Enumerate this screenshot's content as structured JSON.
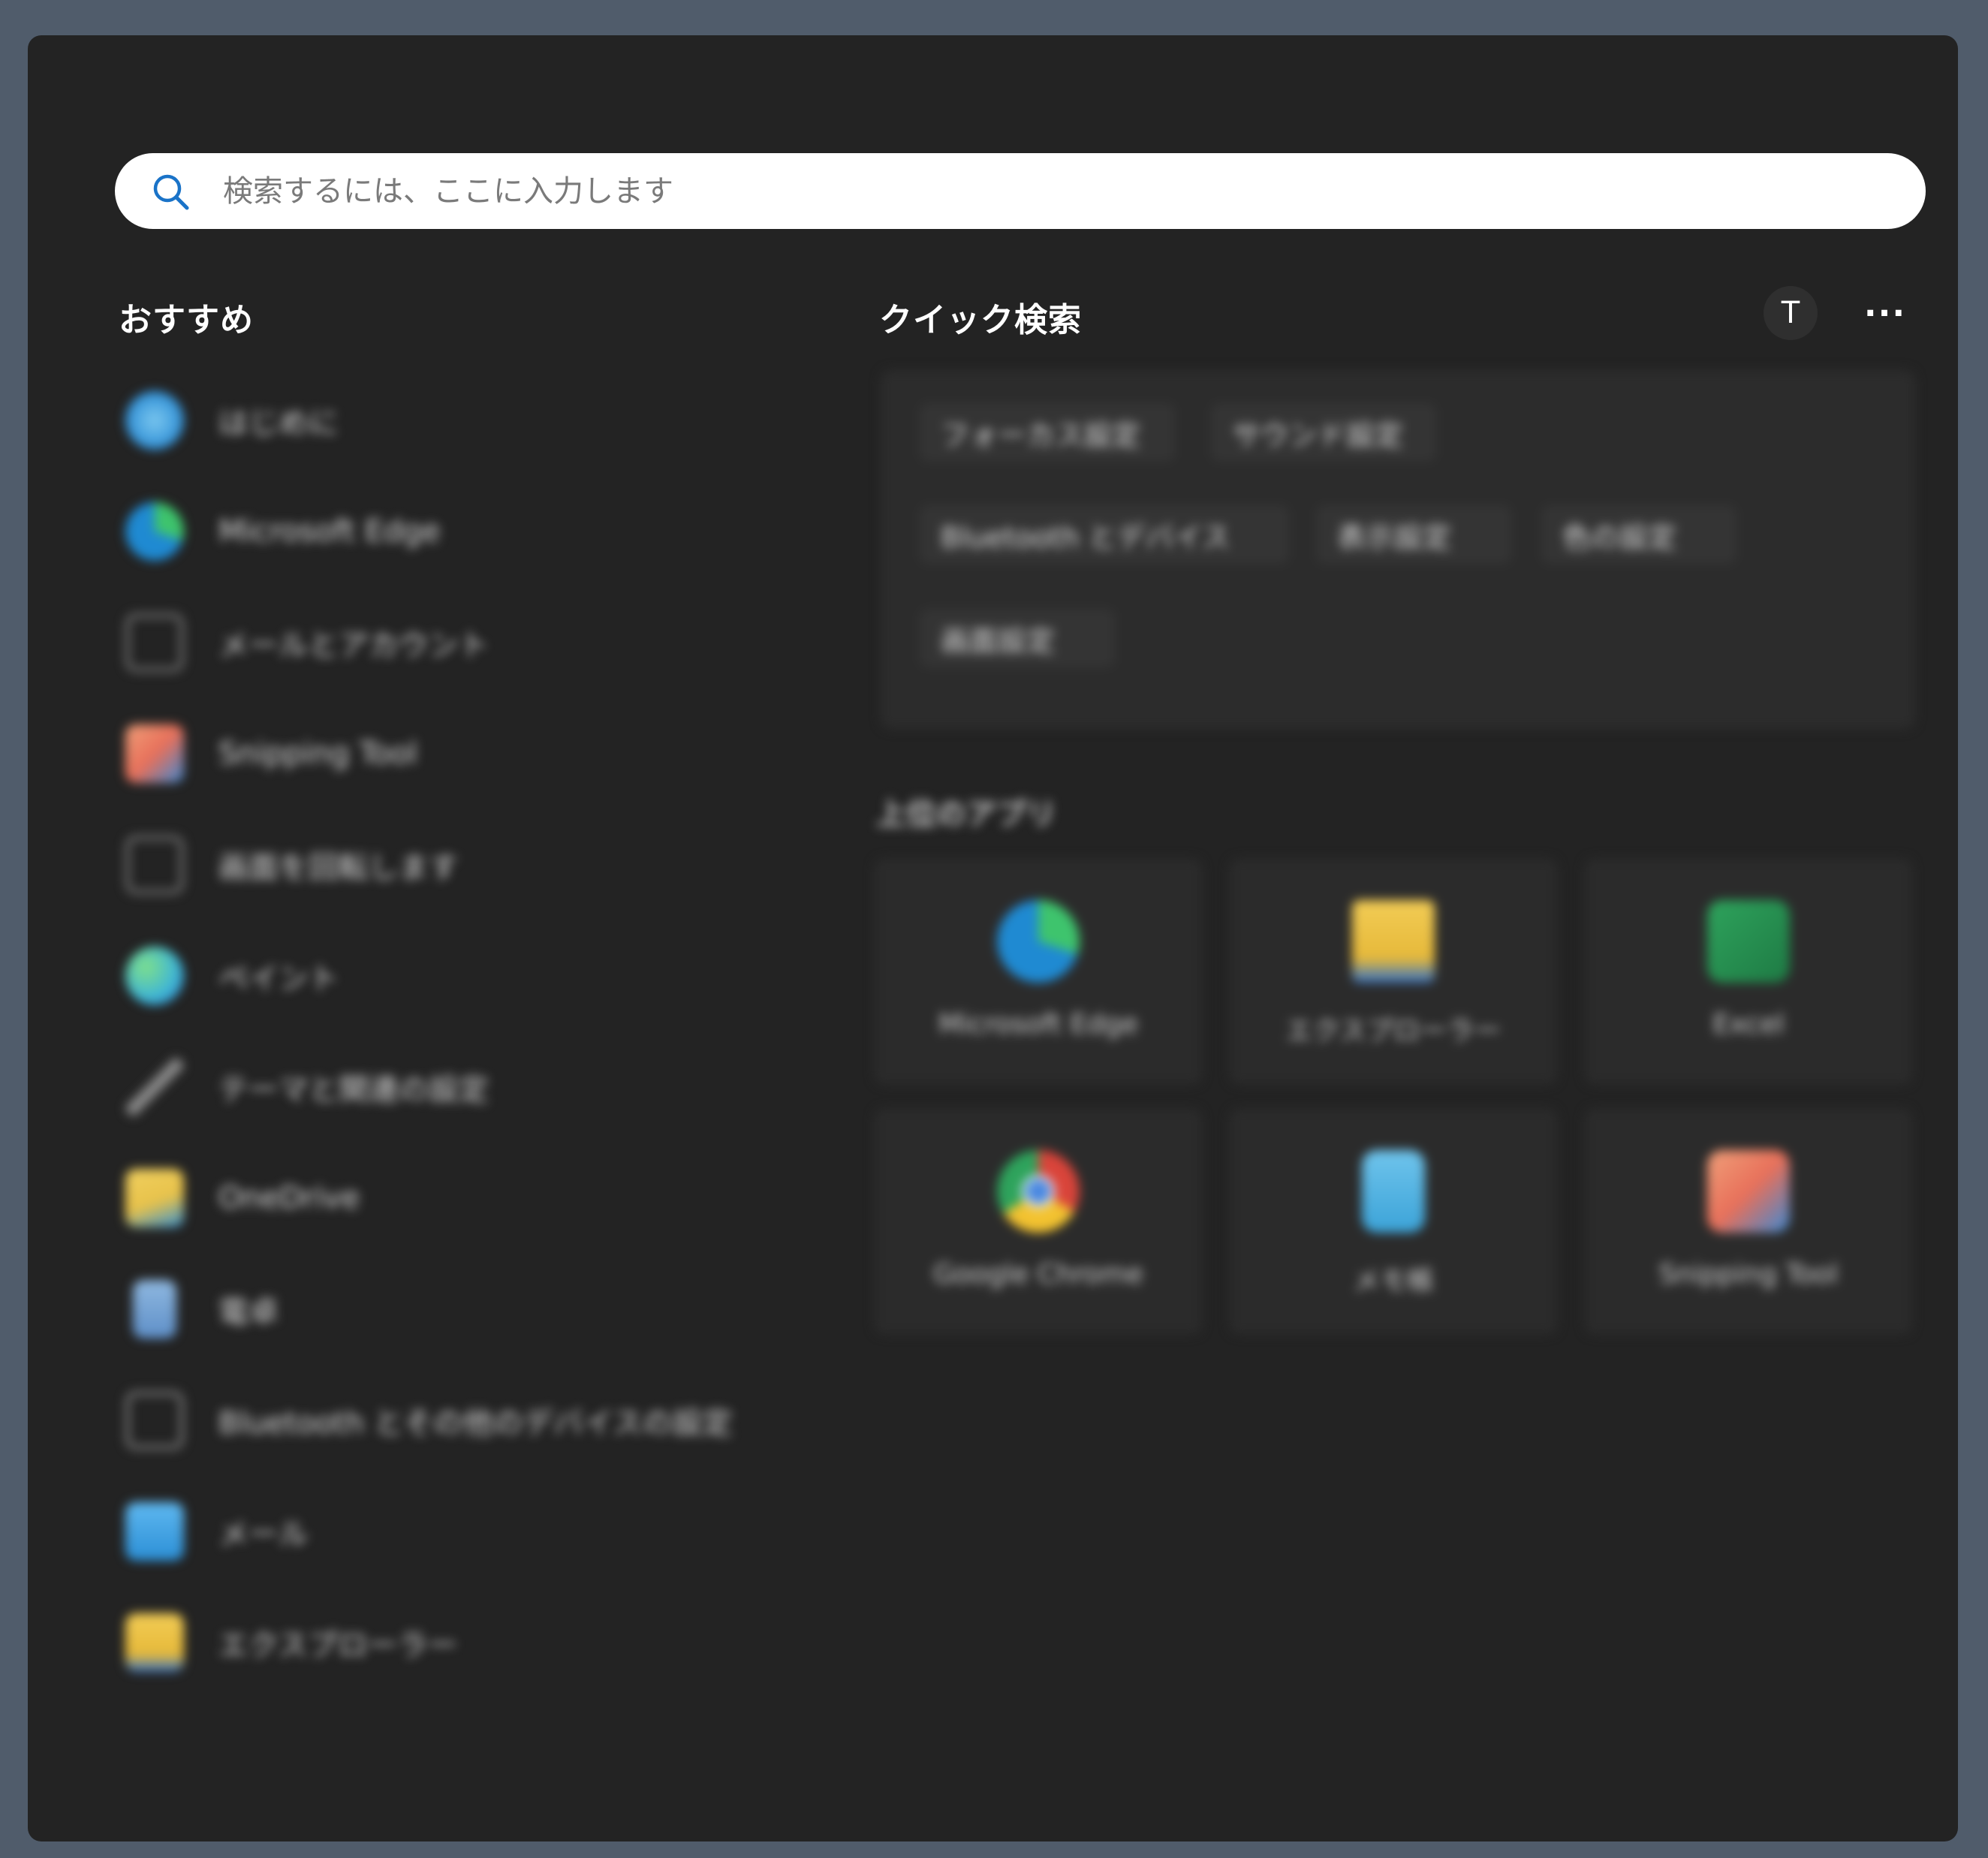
{
  "search": {
    "placeholder": "検索するには、ここに入力します"
  },
  "recommended": {
    "title": "おすすめ",
    "items": [
      {
        "label": "はじめに",
        "icon": "get-started-icon",
        "color": "#3aa0e0"
      },
      {
        "label": "Microsoft Edge",
        "icon": "edge-icon",
        "color": "#1f8ad2"
      },
      {
        "label": "メールとアカウント",
        "icon": "mail-accounts-icon",
        "color": "#6e6e6e"
      },
      {
        "label": "Snipping Tool",
        "icon": "snipping-tool-icon",
        "color": "#e8705a"
      },
      {
        "label": "画面を回転します",
        "icon": "rotate-screen-icon",
        "color": "#6e6e6e"
      },
      {
        "label": "ペイント",
        "icon": "paint-icon",
        "color": "#3db4d8"
      },
      {
        "label": "テーマと関連の設定",
        "icon": "pen-icon",
        "color": "#8a8a8a"
      },
      {
        "label": "OneDrive",
        "icon": "onedrive-icon",
        "color": "#e8c24a"
      },
      {
        "label": "電卓",
        "icon": "calculator-icon",
        "color": "#5e8fc8"
      },
      {
        "label": "Bluetooth とその他のデバイスの設定",
        "icon": "devices-icon",
        "color": "#777777"
      },
      {
        "label": "メール",
        "icon": "mail-icon",
        "color": "#2b8fd6"
      },
      {
        "label": "エクスプローラー",
        "icon": "folder-icon",
        "color": "#e6b93a"
      }
    ]
  },
  "quick_search": {
    "title": "クイック検索",
    "avatar_letter": "T",
    "more_label": "···",
    "tags": [
      "フォーカス設定",
      "サウンド設定",
      "Bluetooth とデバイス",
      "表示設定",
      "色の設定",
      "画面設定"
    ]
  },
  "top_apps": {
    "title": "上位のアプリ",
    "apps": [
      {
        "label": "Microsoft Edge",
        "icon": "edge-icon",
        "color": "#1f8ad2"
      },
      {
        "label": "エクスプローラー",
        "icon": "folder-icon",
        "color": "#e6b93a"
      },
      {
        "label": "Excel",
        "icon": "excel-icon",
        "color": "#1e7a44"
      },
      {
        "label": "Google Chrome",
        "icon": "chrome-icon",
        "color": "#d9443a"
      },
      {
        "label": "メモ帳",
        "icon": "notepad-icon",
        "color": "#3ba3d8"
      },
      {
        "label": "Snipping Tool",
        "icon": "snipping-tool-icon",
        "color": "#e8705a"
      }
    ]
  }
}
